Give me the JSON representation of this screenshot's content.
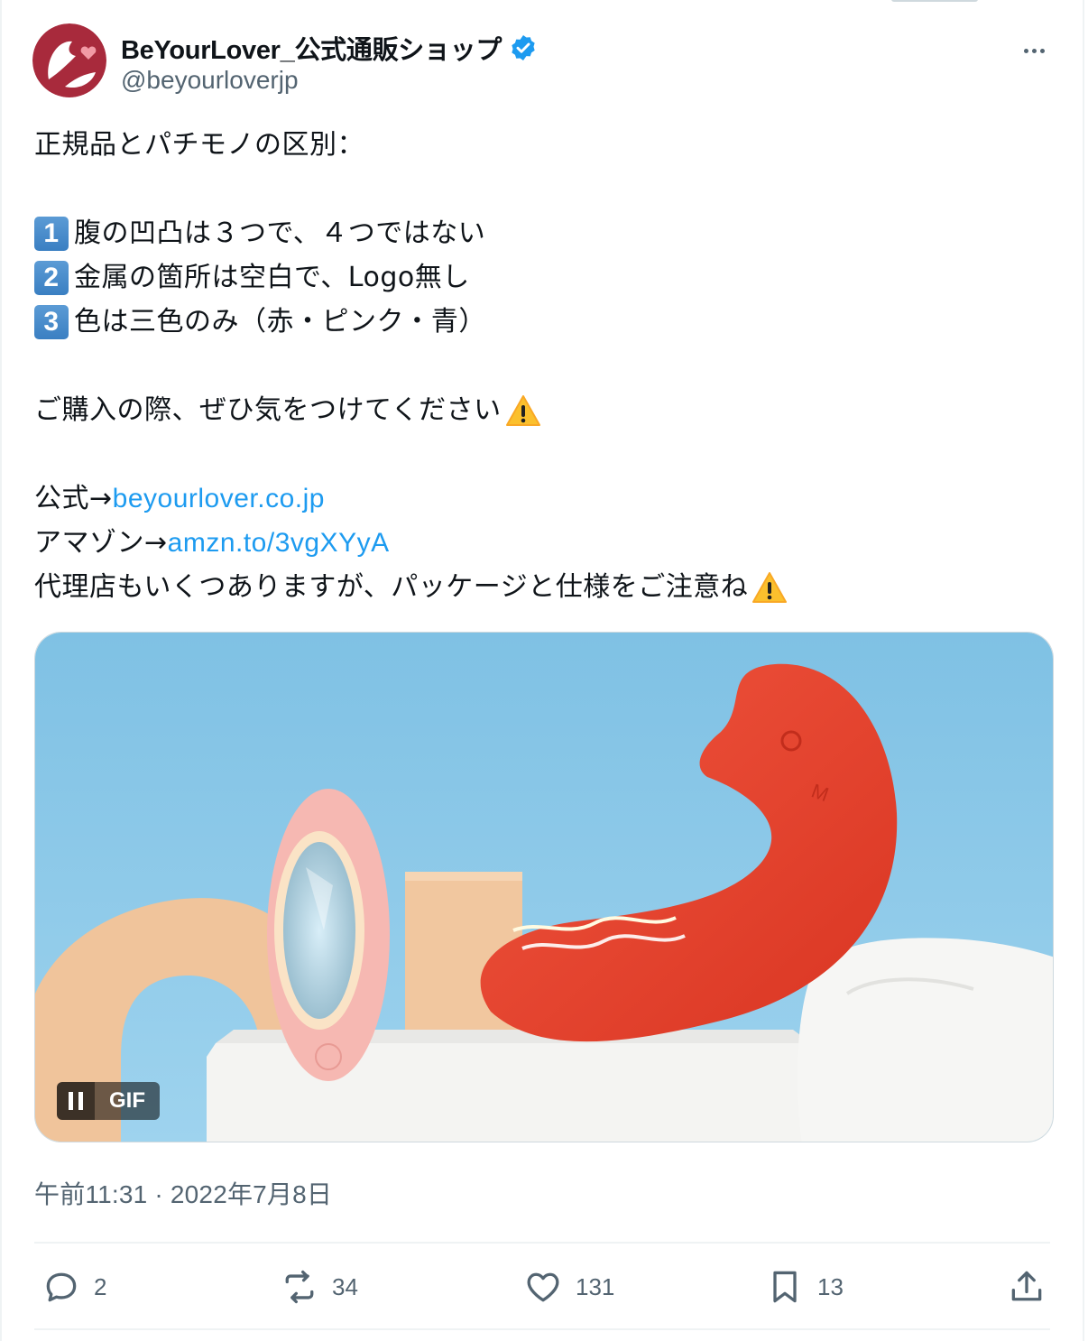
{
  "account": {
    "display_name": "BeYourLover_公式通販ショップ",
    "handle": "@beyourloverjp",
    "verified": true
  },
  "tweet": {
    "line1": "正規品とパチモノの区別：",
    "items": [
      {
        "number": "1",
        "text": "腹の凹凸は３つで、４つではない"
      },
      {
        "number": "2",
        "text": "金属の箇所は空白で、Logo無し"
      },
      {
        "number": "3",
        "text": "色は三色のみ（赤・ピンク・青）"
      }
    ],
    "caution": "ご購入の際、ぜひ気をつけてください",
    "official_label": "公式→",
    "official_link": "beyourlover.co.jp",
    "amazon_label": "アマゾン→",
    "amazon_link": "amzn.to/3vgXYyA",
    "agency_note": "代理店もいくつありますが、パッケージと仕様をご注意ね",
    "warning_icon": "warning-icon"
  },
  "media": {
    "badge": "GIF",
    "colors": {
      "sky": "#8fc8e6",
      "pink": "#f6b8b2",
      "red": "#e8402d",
      "arch": "#f0c49b",
      "white": "#f4f4f2"
    }
  },
  "timestamp": "午前11:31 · 2022年7月8日",
  "actions": {
    "replies": "2",
    "retweets": "34",
    "likes": "131",
    "bookmarks": "13"
  },
  "colors": {
    "link": "#1d9bf0",
    "secondary": "#536471",
    "verified": "#1d9bf0"
  }
}
